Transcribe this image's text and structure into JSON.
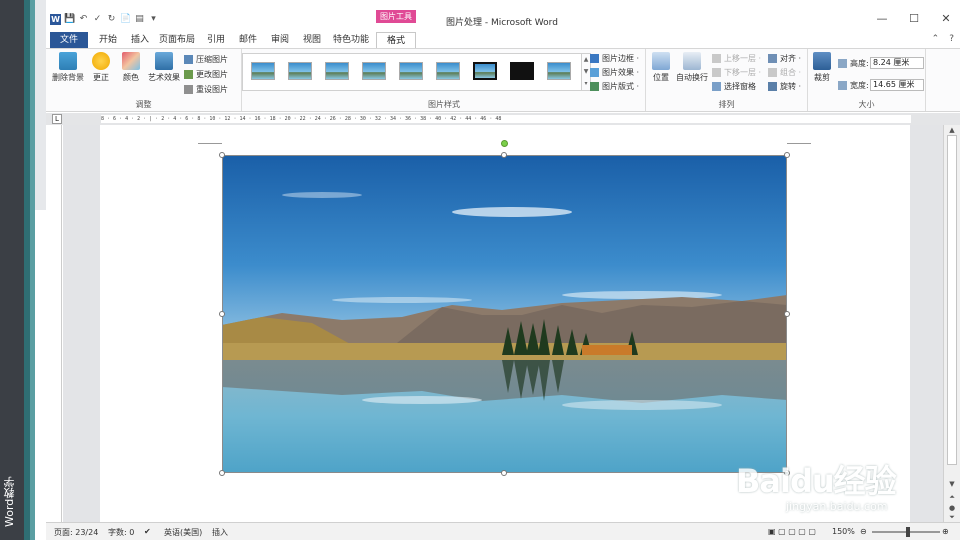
{
  "sidebar_label": "Word教学",
  "window": {
    "title": "图片处理 - Microsoft Word",
    "context_tab_group": "图片工具"
  },
  "quick_access": [
    "W",
    "💾",
    "↶",
    "✓",
    "↻",
    "📄",
    "▤",
    "▾"
  ],
  "tabs": [
    {
      "label": "文件"
    },
    {
      "label": "开始"
    },
    {
      "label": "插入"
    },
    {
      "label": "页面布局"
    },
    {
      "label": "引用"
    },
    {
      "label": "邮件"
    },
    {
      "label": "审阅"
    },
    {
      "label": "视图"
    },
    {
      "label": "特色功能"
    },
    {
      "label": "格式"
    }
  ],
  "ribbon": {
    "adjust": {
      "label": "调整",
      "remove_bg": "删除背景",
      "correct": "更正",
      "color": "颜色",
      "artistic": "艺术效果",
      "compress": "压缩图片",
      "change": "更改图片",
      "reset": "重设图片"
    },
    "styles": {
      "label": "图片样式",
      "border": "图片边框 ·",
      "effects": "图片效果 ·",
      "layout": "图片版式 ·"
    },
    "arrange": {
      "label": "排列",
      "position": "位置",
      "wrap": "自动换行",
      "bring_forward": "上移一层 ·",
      "send_backward": "下移一层 ·",
      "selection_pane": "选择窗格",
      "align": "对齐 ·",
      "group": "组合 ·",
      "rotate": "旋转 ·"
    },
    "size": {
      "label": "大小",
      "crop": "裁剪",
      "height_label": "高度:",
      "height_value": "8.24 厘米",
      "width_label": "宽度:",
      "width_value": "14.65 厘米"
    }
  },
  "ruler_text": "8 · 6 · 4 · 2 · | · 2 · 4 · 6 · 8 · 10 · 12 · 14 · 16 · 18 · 20 · 22 · 24 · 26 · 28 · 30 · 32 · 34 · 36 · 38 · 40 · 42 · 44 · 46 · 48",
  "status": {
    "page": "页面: 23/24",
    "words": "字数: 0",
    "language": "英语(美国)",
    "mode": "插入",
    "zoom": "150%"
  },
  "watermark": {
    "main": "Baidu经验",
    "sub": "jingyan.baidu.com"
  },
  "colors": {
    "file_tab": "#2b5797",
    "context_tab": "#e04a95"
  }
}
